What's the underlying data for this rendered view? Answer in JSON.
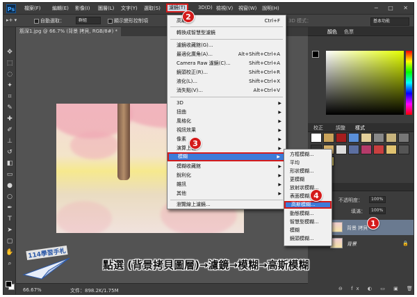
{
  "app": {
    "logo": "Ps",
    "window_buttons": "─ □ ✕"
  },
  "menubar": {
    "items": [
      "檔案(F)",
      "編輯(E)",
      "影像(I)",
      "圖層(L)",
      "文字(Y)",
      "選取(S)",
      "濾鏡(T)",
      "3D(D)",
      "檢視(V)",
      "視窗(W)",
      "說明(H)"
    ],
    "active_item": "濾鏡(T)"
  },
  "options_bar": {
    "auto_select_label": "自動選取：",
    "auto_select_value": "群組",
    "show_transform_label": "顯示變形控制項",
    "mode_label": "3D 模式：",
    "workspace": "基本功能"
  },
  "document": {
    "tab_title": "筋深1.jpg @ 66.7% (背景 拷貝, RGB/8#) *",
    "zoom": "66.67%",
    "doc_info": "文件：898.2K/1.75M"
  },
  "filter_menu": {
    "items": [
      {
        "label": "高斯",
        "shortcut": "Ctrl+F"
      },
      {
        "label": "轉換成智慧型濾鏡"
      },
      {
        "label": "濾鏡收藏館(G)..."
      },
      {
        "label": "最適化廣角(A)...",
        "shortcut": "Alt+Shift+Ctrl+A"
      },
      {
        "label": "Camera Raw 濾鏡(C)...",
        "shortcut": "Shift+Ctrl+A"
      },
      {
        "label": "鏡頭校正(R)...",
        "shortcut": "Shift+Ctrl+R"
      },
      {
        "label": "液化(L)...",
        "shortcut": "Shift+Ctrl+X"
      },
      {
        "label": "消失點(V)...",
        "shortcut": "Alt+Ctrl+V"
      },
      {
        "label": "3D"
      },
      {
        "label": "扭曲"
      },
      {
        "label": "風格化"
      },
      {
        "label": "視訊效果"
      },
      {
        "label": "像素"
      },
      {
        "label": "演算上色"
      },
      {
        "label": "模糊"
      },
      {
        "label": "模糊收藏館"
      },
      {
        "label": "銳利化"
      },
      {
        "label": "雜訊"
      },
      {
        "label": "其他"
      },
      {
        "label": "瀏覽線上濾鏡..."
      }
    ],
    "highlighted": "模糊"
  },
  "blur_submenu": {
    "items": [
      "方框模糊...",
      "平均",
      "形狀模糊...",
      "更模糊",
      "放射狀模糊...",
      "表面模糊...",
      "高斯模糊...",
      "動態模糊...",
      "智慧型模糊...",
      "模糊",
      "鏡頭模糊..."
    ],
    "highlighted": "高斯模糊..."
  },
  "panels": {
    "color_tabs": [
      "顏色",
      "色票"
    ],
    "style_tabs": [
      "校正",
      "調整",
      "樣式"
    ],
    "workspace_label": "3D 模式：",
    "layers": {
      "opacity_label": "不透明度：",
      "opacity_value": "100%",
      "fill_label": "填滿：",
      "fill_value": "100%",
      "items": [
        {
          "name": "背景 拷貝"
        },
        {
          "name": "背景"
        }
      ]
    }
  },
  "step_badges": [
    "1",
    "2",
    "3",
    "4"
  ],
  "watermark": "114學習手札",
  "caption": "點選 (背景拷貝圖層)→濾鏡→模糊→高斯模糊",
  "colors": {
    "highlight": "#3d7bd9",
    "badge": "#d41b1b",
    "panel": "#3c3c3c"
  }
}
